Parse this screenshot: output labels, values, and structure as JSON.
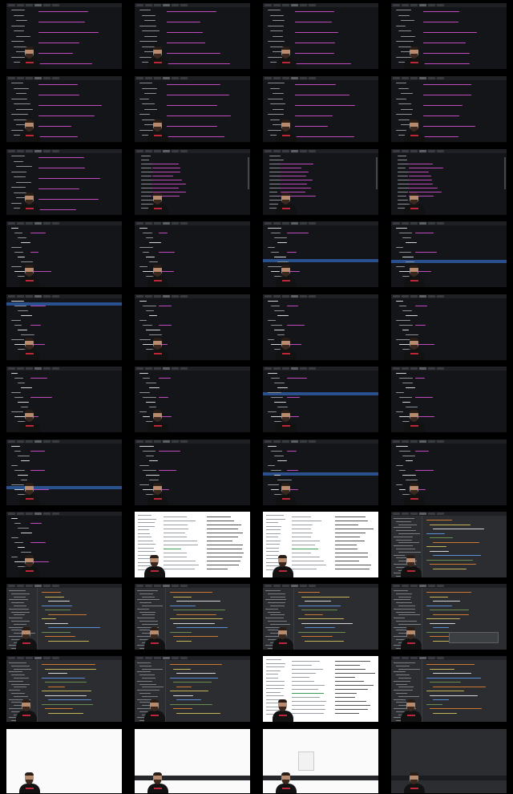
{
  "sheet": {
    "rows": 11,
    "cols": 4,
    "background": "#000000"
  },
  "tiles": [
    {
      "id": 1,
      "kind": "dark-editor",
      "variant": "list-entries"
    },
    {
      "id": 2,
      "kind": "dark-editor",
      "variant": "list-entries"
    },
    {
      "id": 3,
      "kind": "dark-editor",
      "variant": "list-entries"
    },
    {
      "id": 4,
      "kind": "dark-editor",
      "variant": "list-entries"
    },
    {
      "id": 5,
      "kind": "dark-editor",
      "variant": "list-entries"
    },
    {
      "id": 6,
      "kind": "dark-editor",
      "variant": "list-entries"
    },
    {
      "id": 7,
      "kind": "dark-editor",
      "variant": "list-entries"
    },
    {
      "id": 8,
      "kind": "dark-editor",
      "variant": "list-entries"
    },
    {
      "id": 9,
      "kind": "dark-editor",
      "variant": "list-entries"
    },
    {
      "id": 10,
      "kind": "dark-editor",
      "variant": "string-list"
    },
    {
      "id": 11,
      "kind": "dark-editor",
      "variant": "string-list"
    },
    {
      "id": 12,
      "kind": "dark-editor",
      "variant": "string-list"
    },
    {
      "id": 13,
      "kind": "dark-editor",
      "variant": "selection-top"
    },
    {
      "id": 14,
      "kind": "dark-editor",
      "variant": "tree"
    },
    {
      "id": 15,
      "kind": "dark-editor",
      "variant": "tree-highlight"
    },
    {
      "id": 16,
      "kind": "dark-editor",
      "variant": "tree-highlight"
    },
    {
      "id": 17,
      "kind": "dark-editor",
      "variant": "tree-highlight-top"
    },
    {
      "id": 18,
      "kind": "dark-editor",
      "variant": "tree"
    },
    {
      "id": 19,
      "kind": "dark-editor",
      "variant": "tree"
    },
    {
      "id": 20,
      "kind": "dark-editor",
      "variant": "tree"
    },
    {
      "id": 21,
      "kind": "dark-editor",
      "variant": "tree"
    },
    {
      "id": 22,
      "kind": "dark-editor",
      "variant": "tree"
    },
    {
      "id": 23,
      "kind": "dark-editor",
      "variant": "tree-highlight"
    },
    {
      "id": 24,
      "kind": "dark-editor",
      "variant": "tree"
    },
    {
      "id": 25,
      "kind": "dark-editor",
      "variant": "tree-highlight-bottom"
    },
    {
      "id": 26,
      "kind": "dark-editor",
      "variant": "tree"
    },
    {
      "id": 27,
      "kind": "dark-editor",
      "variant": "tree-highlight"
    },
    {
      "id": 28,
      "kind": "dark-editor",
      "variant": "tree"
    },
    {
      "id": 29,
      "kind": "dark-editor",
      "variant": "tree"
    },
    {
      "id": 30,
      "kind": "docs-page",
      "variant": "table"
    },
    {
      "id": 31,
      "kind": "docs-page",
      "variant": "table"
    },
    {
      "id": 32,
      "kind": "ide",
      "variant": "java"
    },
    {
      "id": 33,
      "kind": "ide",
      "variant": "java"
    },
    {
      "id": 34,
      "kind": "ide",
      "variant": "java"
    },
    {
      "id": 35,
      "kind": "ide",
      "variant": "java"
    },
    {
      "id": 36,
      "kind": "ide",
      "variant": "java-popup"
    },
    {
      "id": 37,
      "kind": "ide",
      "variant": "java"
    },
    {
      "id": 38,
      "kind": "ide",
      "variant": "java"
    },
    {
      "id": 39,
      "kind": "docs-page",
      "variant": "table"
    },
    {
      "id": 40,
      "kind": "ide",
      "variant": "java"
    },
    {
      "id": 41,
      "kind": "blank",
      "variant": "white"
    },
    {
      "id": 42,
      "kind": "blank",
      "variant": "white-bar"
    },
    {
      "id": 43,
      "kind": "blank",
      "variant": "white-menu"
    },
    {
      "id": 44,
      "kind": "blank",
      "variant": "dark-bar"
    }
  ],
  "colors": {
    "editor_bg": "#141518",
    "keyword": "#8c8f96",
    "string": "#c04bbd",
    "selection": "#2f5aa3",
    "ide_bg": "#2b2d30",
    "doc_bg": "#ffffff"
  }
}
